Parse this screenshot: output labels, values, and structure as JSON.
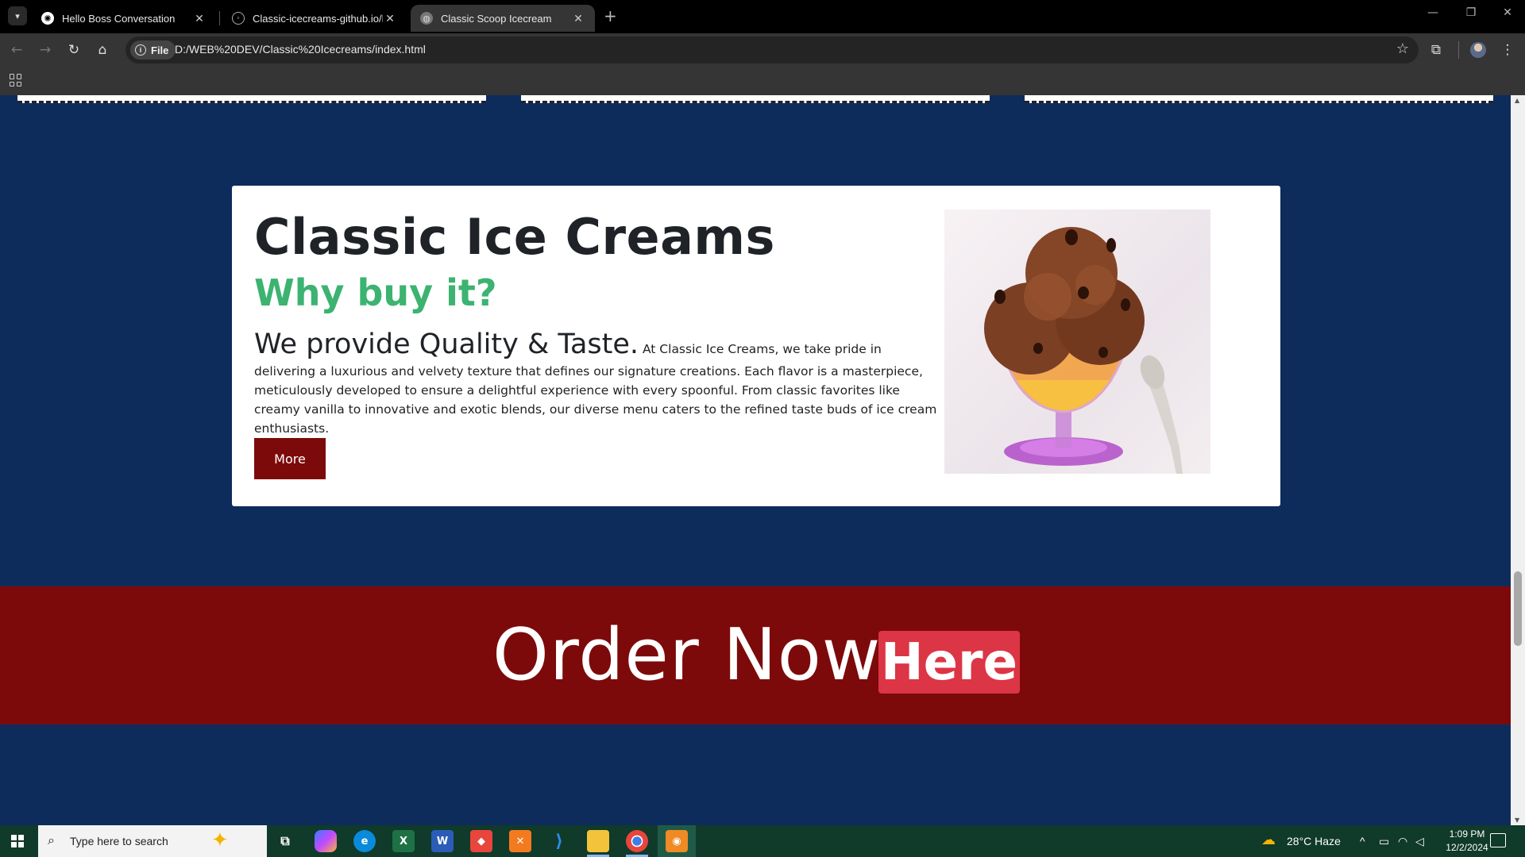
{
  "browser": {
    "tabs": [
      {
        "title": "Hello Boss Conversation",
        "icon": "chatgpt-icon"
      },
      {
        "title": "Classic-icecreams-github.io/README",
        "icon": "github-icon"
      },
      {
        "title": "Classic Scoop Icecream",
        "icon": "globe-icon",
        "active": true
      }
    ],
    "address_chip": "File",
    "url": "D:/WEB%20DEV/Classic%20Icecreams/index.html"
  },
  "page": {
    "card": {
      "title": "Classic Ice Creams",
      "subtitle": "Why buy it?",
      "lead": "We provide Quality & Taste.",
      "body": " At Classic Ice Creams, we take pride in delivering a luxurious and velvety texture that defines our signature creations. Each flavor is a masterpiece, meticulously developed to ensure a delightful experience with every spoonful. From classic favorites like creamy vanilla to innovative and exotic blends, our diverse menu caters to the refined taste buds of ice cream enthusiasts.",
      "button": "More",
      "image": "chocolate-ice-cream-sundae"
    },
    "order": {
      "text": "Order Now",
      "button": "Here"
    },
    "colors": {
      "page_bg": "#0d2c5c",
      "band_bg": "#7d0a0a",
      "subtitle": "#3cb371",
      "here_btn": "#dc3545"
    }
  },
  "taskbar": {
    "search_placeholder": "Type here to search",
    "weather": "28°C  Haze",
    "time": "1:09 PM",
    "date": "12/2/2024"
  }
}
